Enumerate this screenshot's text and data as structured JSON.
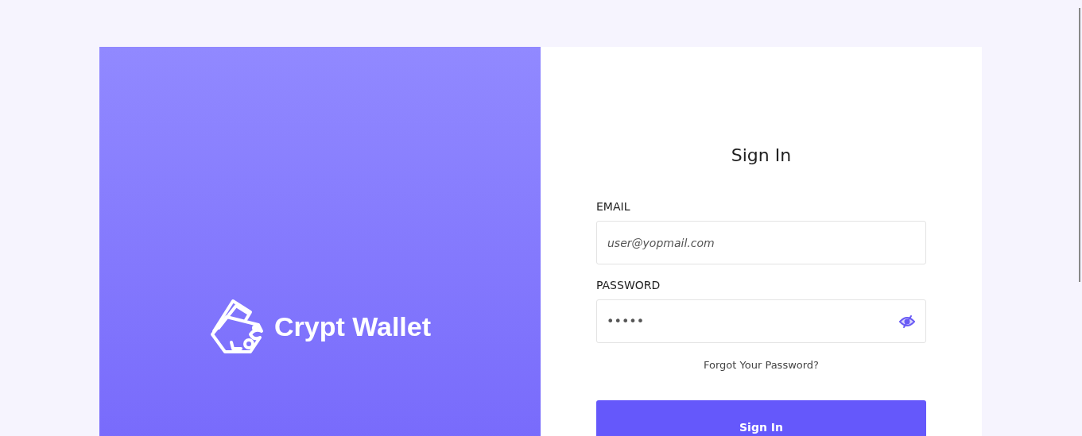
{
  "brand": {
    "name": "Crypt Wallet"
  },
  "form": {
    "title": "Sign In",
    "fields": [
      {
        "kind": "email",
        "label": "EMAIL",
        "placeholder": "user@yopmail.com"
      },
      {
        "kind": "password",
        "label": "PASSWORD",
        "value": "•••••",
        "show_password": false
      }
    ],
    "forgot_link": "Forgot Your Password?",
    "submit": "Sign In"
  }
}
